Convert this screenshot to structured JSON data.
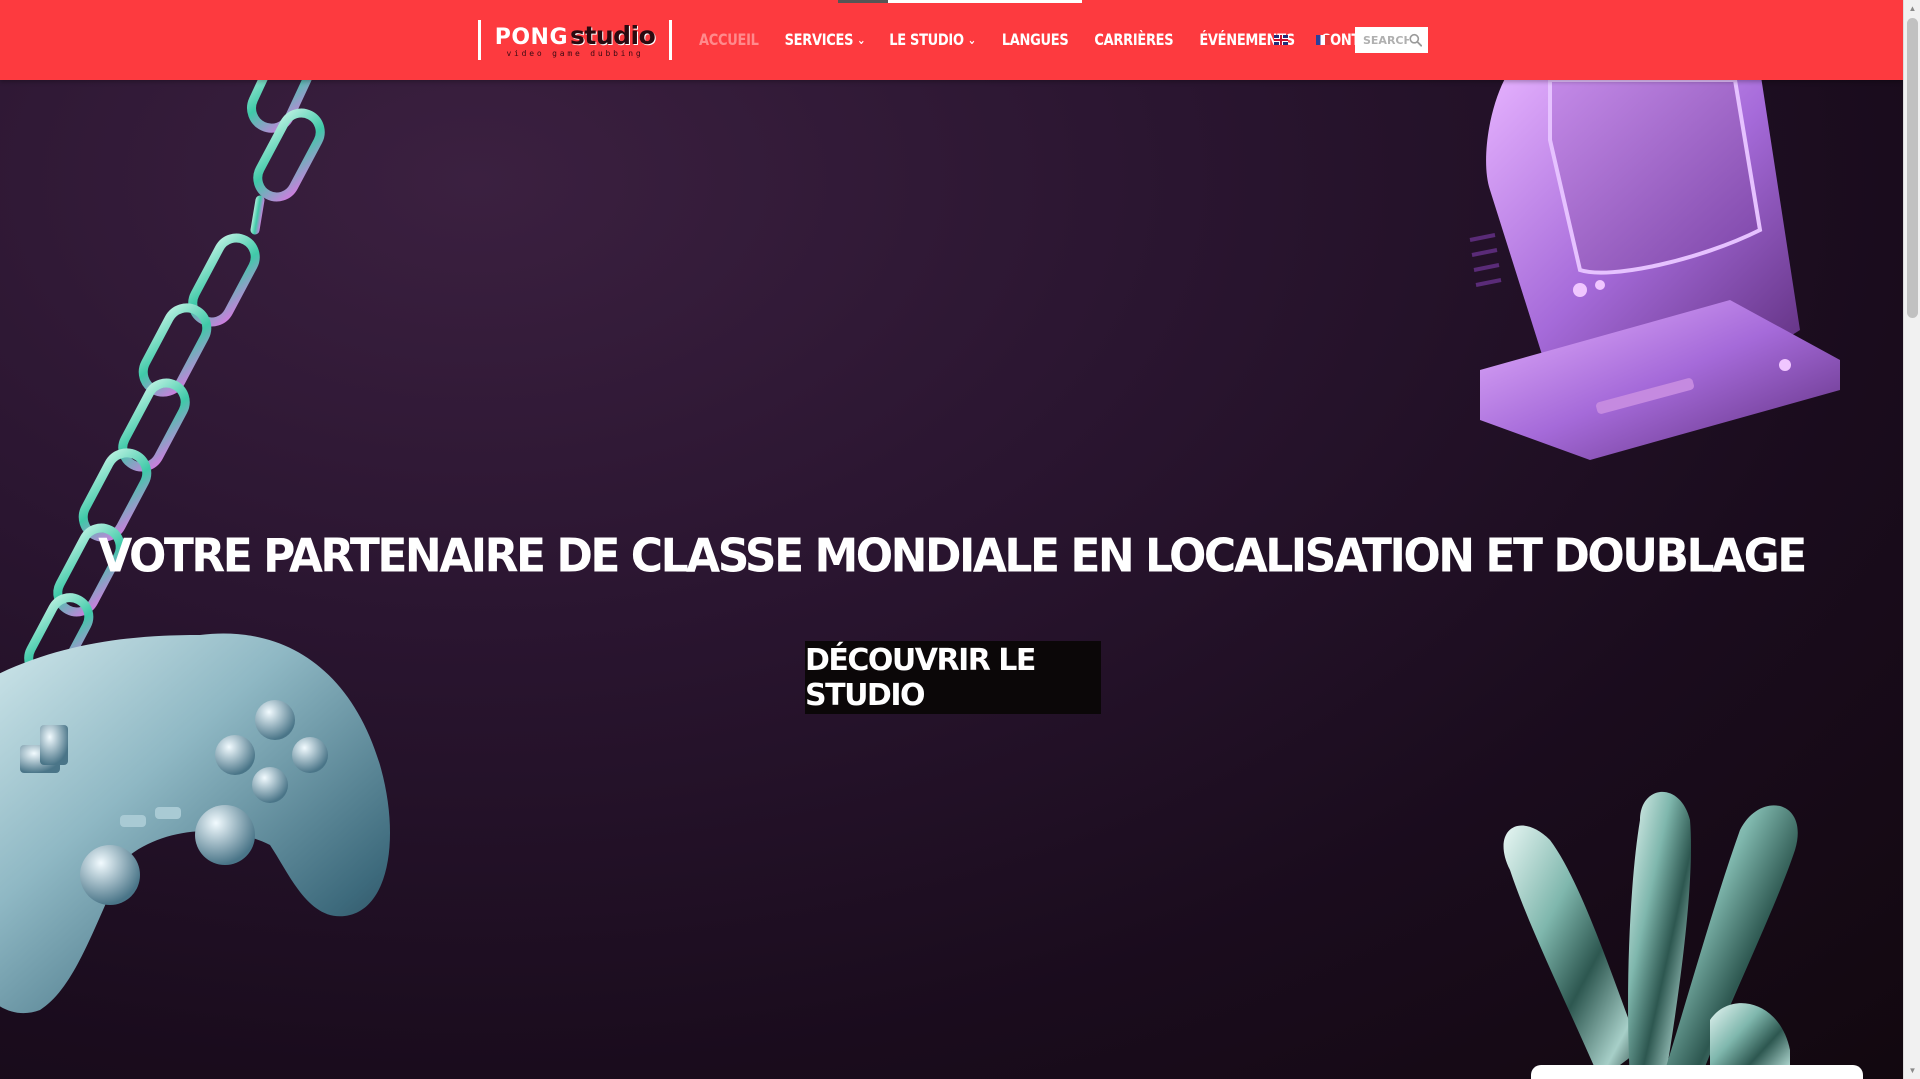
{
  "header": {
    "logo": {
      "brand": "PONG",
      "brand_suffix": "studio",
      "tagline": "video game dubbing"
    },
    "nav": {
      "items": [
        {
          "label": "Accueil",
          "active": true,
          "dropdown": false
        },
        {
          "label": "Services",
          "active": false,
          "dropdown": true
        },
        {
          "label": "Le Studio",
          "active": false,
          "dropdown": true
        },
        {
          "label": "Langues",
          "active": false,
          "dropdown": false
        },
        {
          "label": "Carrières",
          "active": false,
          "dropdown": false
        },
        {
          "label": "Événements",
          "active": false,
          "dropdown": false
        },
        {
          "label": "Contact",
          "active": false,
          "dropdown": false
        }
      ],
      "chevron_icon": "chevron-down-icon"
    },
    "languages": [
      {
        "code": "en",
        "icon": "uk-flag-icon"
      },
      {
        "code": "fr",
        "icon": "france-flag-icon"
      }
    ],
    "search": {
      "placeholder": "SEARCH",
      "icon": "search-icon"
    },
    "colors": {
      "header_bg": "#fd3a3f",
      "active_link": "#ff8a8c",
      "text": "#ffffff"
    }
  },
  "hero": {
    "title": "VOTRE PARTENAIRE DE CLASSE MONDIALE EN LOCALISATION ET DOUBLAGE",
    "cta_label": "DÉCOUVRIR LE STUDIO",
    "decorations": [
      "chain-illustration",
      "game-controller-illustration",
      "retro-computer-illustration",
      "chrome-splash-illustration"
    ],
    "colors": {
      "bg_dark": "#1a0c1d",
      "bg_light": "#3b2040",
      "cta_bg": "#0b0708"
    }
  }
}
